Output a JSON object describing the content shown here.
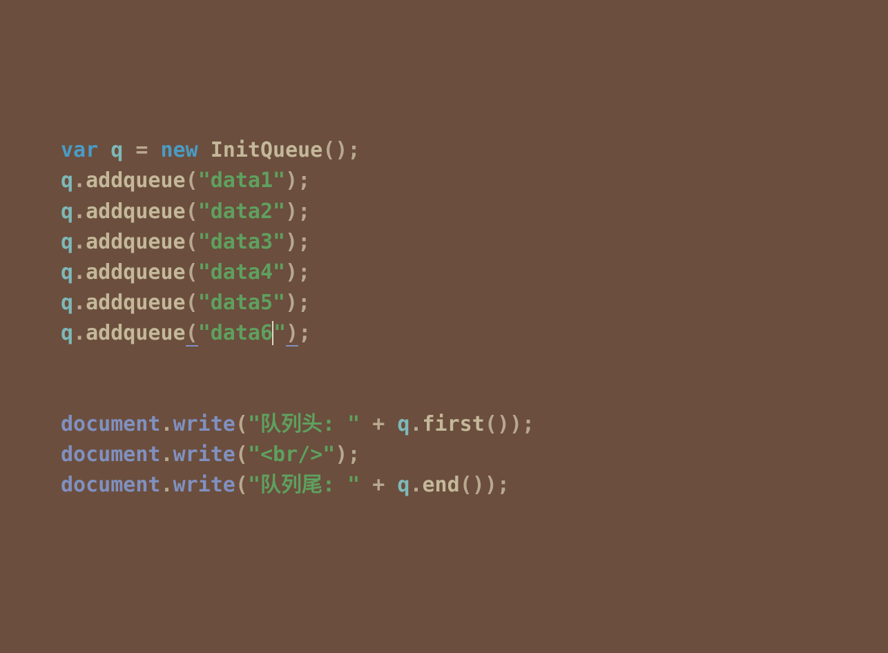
{
  "code": {
    "line1": {
      "kw_var": "var",
      "ident": "q",
      "op_eq": "=",
      "kw_new": "new",
      "func": "InitQueue",
      "paren_open": "(",
      "paren_close": ")",
      "semi": ";"
    },
    "line2": {
      "ident": "q",
      "dot": ".",
      "method": "addqueue",
      "paren_open": "(",
      "string": "\"data1\"",
      "paren_close": ")",
      "semi": ";"
    },
    "line3": {
      "ident": "q",
      "dot": ".",
      "method": "addqueue",
      "paren_open": "(",
      "string": "\"data2\"",
      "paren_close": ")",
      "semi": ";"
    },
    "line4": {
      "ident": "q",
      "dot": ".",
      "method": "addqueue",
      "paren_open": "(",
      "string": "\"data3\"",
      "paren_close": ")",
      "semi": ";"
    },
    "line5": {
      "ident": "q",
      "dot": ".",
      "method": "addqueue",
      "paren_open": "(",
      "string": "\"data4\"",
      "paren_close": ")",
      "semi": ";"
    },
    "line6": {
      "ident": "q",
      "dot": ".",
      "method": "addqueue",
      "paren_open": "(",
      "string": "\"data5\"",
      "paren_close": ")",
      "semi": ";"
    },
    "line7": {
      "ident": "q",
      "dot": ".",
      "method": "addqueue",
      "paren_open": "(",
      "string_a": "\"data6",
      "string_b": "\"",
      "paren_close": ")",
      "semi": ";"
    },
    "line9": {
      "object": "document",
      "dot": ".",
      "method": "write",
      "paren_open": "(",
      "string": "\"队列头: \"",
      "op_plus": "+",
      "ident": "q",
      "dot2": ".",
      "method2": "first",
      "paren_open2": "(",
      "paren_close2": ")",
      "paren_close": ")",
      "semi": ";"
    },
    "line10": {
      "object": "document",
      "dot": ".",
      "method": "write",
      "paren_open": "(",
      "string": "\"<br/>\"",
      "paren_close": ")",
      "semi": ";"
    },
    "line11": {
      "object": "document",
      "dot": ".",
      "method": "write",
      "paren_open": "(",
      "string": "\"队列尾: \"",
      "op_plus": "+",
      "ident": "q",
      "dot2": ".",
      "method2": "end",
      "paren_open2": "(",
      "paren_close2": ")",
      "paren_close": ")",
      "semi": ";"
    }
  }
}
